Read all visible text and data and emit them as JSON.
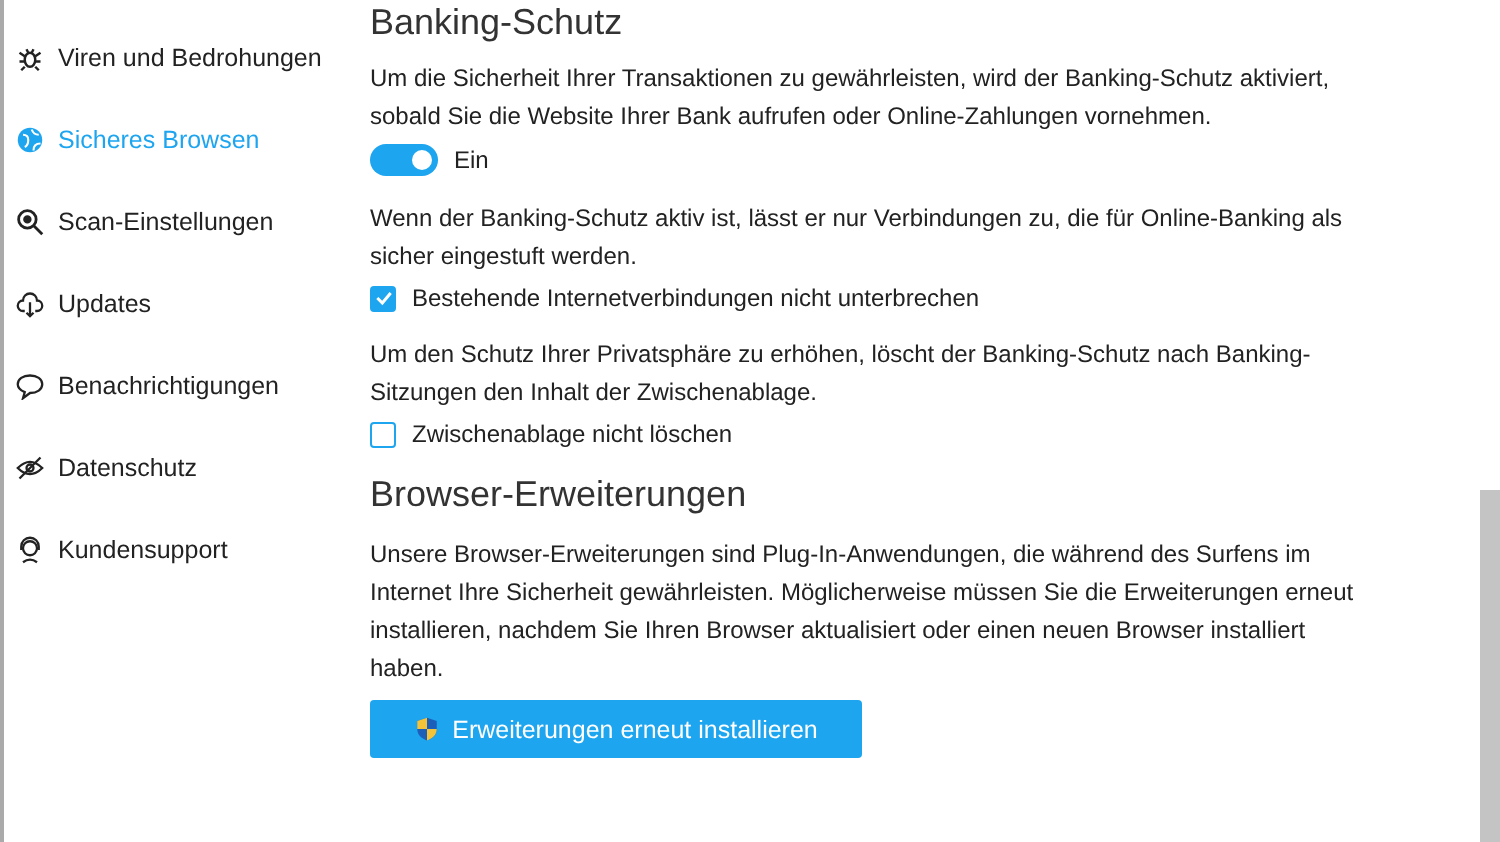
{
  "sidebar": {
    "items": [
      {
        "label": "Viren und Bedrohungen",
        "selected": false
      },
      {
        "label": "Sicheres Browsen",
        "selected": true
      },
      {
        "label": "Scan-Einstellungen",
        "selected": false
      },
      {
        "label": "Updates",
        "selected": false
      },
      {
        "label": "Benachrichtigungen",
        "selected": false
      },
      {
        "label": "Datenschutz",
        "selected": false
      },
      {
        "label": "Kundensupport",
        "selected": false
      }
    ]
  },
  "banking": {
    "title": "Banking-Schutz",
    "items": [
      {
        "kind": "text",
        "text": "Um die Sicherheit Ihrer Transaktionen zu gewährleisten, wird der Banking-Schutz aktiviert, sobald Sie die Website Ihrer Bank aufrufen oder Online-Zahlungen vornehmen."
      },
      {
        "kind": "toggle",
        "label": "Ein",
        "on": true
      },
      {
        "kind": "text",
        "text": "Wenn der Banking-Schutz aktiv ist, lässt er nur Verbindungen zu, die für Online-Banking als sicher eingestuft werden."
      },
      {
        "kind": "checkbox",
        "label": "Bestehende Internetverbindungen nicht unterbrechen",
        "checked": true
      },
      {
        "kind": "text",
        "text": "Um den Schutz Ihrer Privatsphäre zu erhöhen, löscht der Banking-Schutz nach Banking-Sitzungen den Inhalt der Zwischenablage."
      },
      {
        "kind": "checkbox",
        "label": "Zwischenablage nicht löschen",
        "checked": false
      }
    ]
  },
  "extensions": {
    "title": "Browser-Erweiterungen",
    "text": "Unsere Browser-Erweiterungen sind Plug-In-Anwendungen, die während des Surfens im Internet Ihre Sicherheit gewährleisten. Möglicherweise müssen Sie die Erweiterungen erneut installieren, nachdem Sie Ihren Browser aktualisiert oder einen neuen Browser installiert haben.",
    "button": "Erweiterungen erneut installieren"
  }
}
